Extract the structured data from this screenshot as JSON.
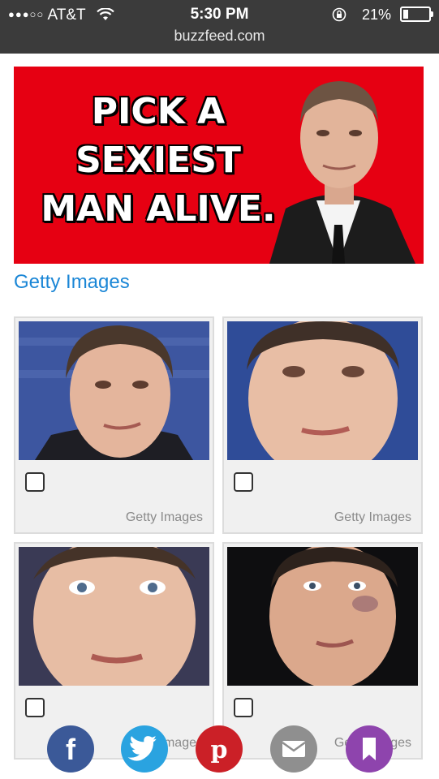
{
  "status_bar": {
    "signal": "●●●○○",
    "carrier": "AT&T",
    "time": "5:30 PM",
    "battery_percent": "21%",
    "battery_level": 0.21,
    "url": "buzzfeed.com"
  },
  "banner": {
    "headline_line1": "PICK A",
    "headline_line2": "SEXIEST",
    "headline_line3": "MAN ALIVE."
  },
  "credit_link": "Getty Images",
  "cards": [
    {
      "credit": "Getty Images",
      "checked": false
    },
    {
      "credit": "Getty Images",
      "checked": false
    },
    {
      "credit": "Getty Images",
      "checked": false
    },
    {
      "credit": "Getty Images",
      "checked": false
    }
  ],
  "share_bar": [
    {
      "icon": "facebook-icon",
      "color": "#3b5998"
    },
    {
      "icon": "twitter-icon",
      "color": "#2aa3e0"
    },
    {
      "icon": "pinterest-icon",
      "color": "#cb2027"
    },
    {
      "icon": "mail-icon",
      "color": "#8f8f8f"
    },
    {
      "icon": "bookmark-icon",
      "color": "#8e44ad"
    }
  ]
}
